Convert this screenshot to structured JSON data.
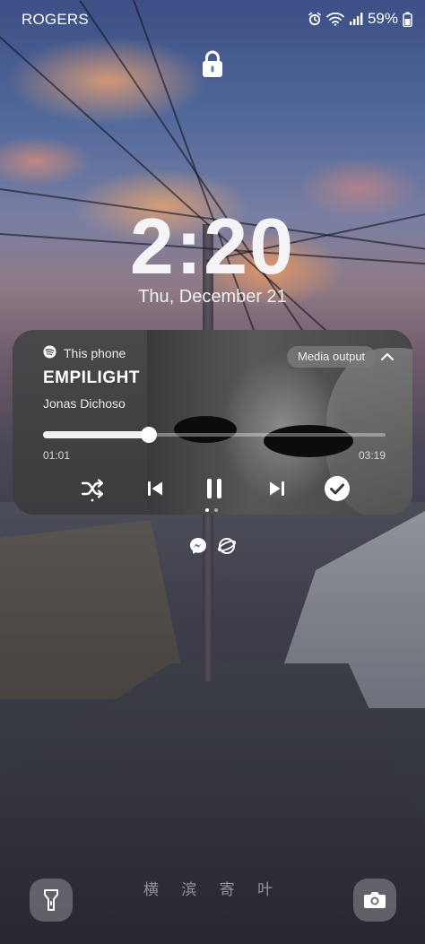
{
  "status_bar": {
    "carrier": "ROGERS",
    "battery_percent": "59%",
    "icons": [
      "alarm-icon",
      "wifi-icon",
      "signal-icon",
      "battery-icon"
    ]
  },
  "lock_screen": {
    "time": "2:20",
    "date": "Thu, December 21"
  },
  "media_player": {
    "source_app_icon": "spotify-icon",
    "source_label": "This phone",
    "output_button_label": "Media output",
    "title": "EMPILIGHT",
    "artist": "Jonas Dichoso",
    "elapsed": "01:01",
    "duration": "03:19",
    "progress_fraction": 0.31,
    "controls": [
      "shuffle-icon",
      "previous-icon",
      "pause-icon",
      "next-icon",
      "saved-check-icon"
    ],
    "page_indicator": {
      "count": 2,
      "active": 0
    }
  },
  "notification_icons": [
    "messenger-icon",
    "globe-icon"
  ],
  "shortcuts": {
    "left": "flashlight-icon",
    "right": "camera-icon"
  },
  "wallpaper": {
    "watermark": "横 滨 寄 叶"
  }
}
